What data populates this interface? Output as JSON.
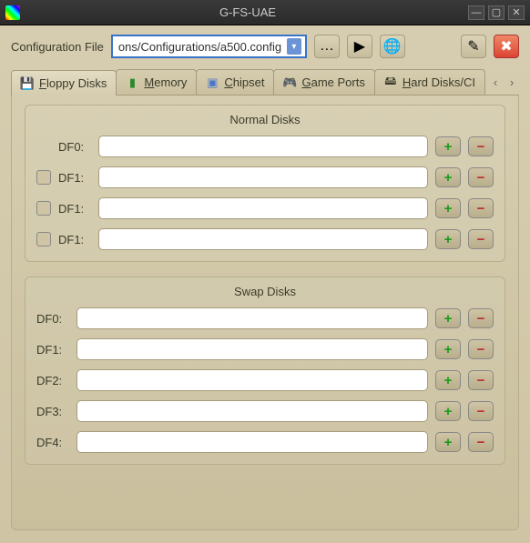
{
  "window": {
    "title": "G-FS-UAE"
  },
  "config": {
    "label": "Configuration File",
    "value": "ons/Configurations/a500.config"
  },
  "tabs": {
    "items": [
      {
        "label": "Floppy Disks",
        "u": "F"
      },
      {
        "label": "Memory",
        "u": "M"
      },
      {
        "label": "Chipset",
        "u": "C"
      },
      {
        "label": "Game Ports",
        "u": "G"
      },
      {
        "label": "Hard Disks/CD",
        "u": "H"
      }
    ]
  },
  "normal": {
    "title": "Normal Disks",
    "rows": [
      {
        "label": "DF0:",
        "checkbox": false,
        "value": ""
      },
      {
        "label": "DF1:",
        "checkbox": true,
        "value": ""
      },
      {
        "label": "DF1:",
        "checkbox": true,
        "value": ""
      },
      {
        "label": "DF1:",
        "checkbox": true,
        "value": ""
      }
    ]
  },
  "swap": {
    "title": "Swap Disks",
    "rows": [
      {
        "label": "DF0:",
        "value": ""
      },
      {
        "label": "DF1:",
        "value": ""
      },
      {
        "label": "DF2:",
        "value": ""
      },
      {
        "label": "DF3:",
        "value": ""
      },
      {
        "label": "DF4:",
        "value": ""
      }
    ]
  }
}
